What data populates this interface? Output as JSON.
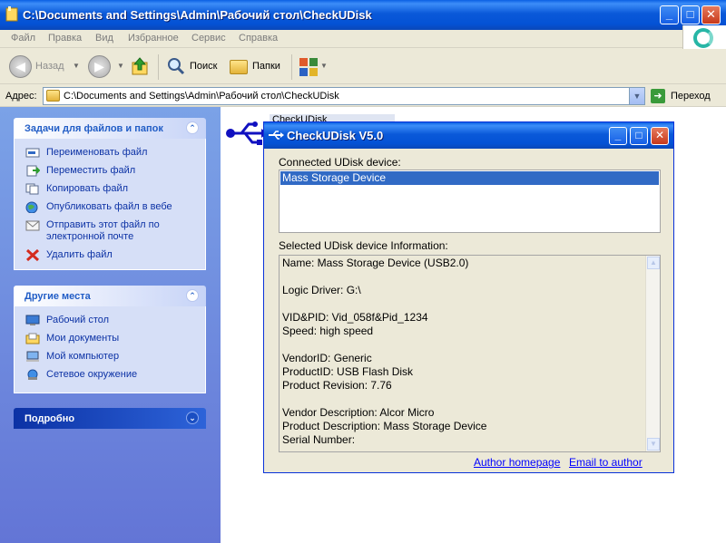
{
  "explorer": {
    "title": "C:\\Documents and Settings\\Admin\\Рабочий стол\\CheckUDisk",
    "window_buttons": {
      "minimize": "_",
      "maximize": "□",
      "close": "✕"
    },
    "menu": [
      "Файл",
      "Правка",
      "Вид",
      "Избранное",
      "Сервис",
      "Справка"
    ],
    "toolbar": {
      "back_label": "Назад",
      "search_label": "Поиск",
      "folders_label": "Папки"
    },
    "address": {
      "label": "Адрес:",
      "value": "C:\\Documents and Settings\\Admin\\Рабочий стол\\CheckUDisk",
      "go_label": "Переход"
    },
    "file_tasks": {
      "title": "Задачи для файлов и папок",
      "items": [
        "Переименовать файл",
        "Переместить файл",
        "Копировать файл",
        "Опубликовать файл в вебе",
        "Отправить этот файл по электронной почте",
        "Удалить файл"
      ]
    },
    "other_places": {
      "title": "Другие места",
      "items": [
        "Рабочий стол",
        "Мои документы",
        "Мой компьютер",
        "Сетевое окружение"
      ]
    },
    "details": {
      "title": "Подробно"
    },
    "file_label": "CheckUDisk"
  },
  "dialog": {
    "title": "CheckUDisk V5.0",
    "connected_label": "Connected UDisk device:",
    "devices": [
      "Mass Storage Device"
    ],
    "selected_info_label": "Selected UDisk device Information:",
    "info_lines": [
      "Name: Mass Storage Device  (USB2.0)",
      "",
      "Logic Driver: G:\\",
      "",
      "VID&PID: Vid_058f&Pid_1234",
      "Speed: high speed",
      "",
      "VendorID: Generic",
      "ProductID: USB Flash Disk",
      "Product Revision: 7.76",
      "",
      "Vendor Description: Alcor Micro",
      "Product Description: Mass Storage Device",
      "Serial Number:"
    ],
    "author_homepage": "Author homepage",
    "email_author": "Email to author"
  },
  "colors": {
    "accent": "#0a59d9",
    "selection": "#316ac5",
    "link": "#0000ff",
    "taskpane": "#6d8ee0"
  }
}
